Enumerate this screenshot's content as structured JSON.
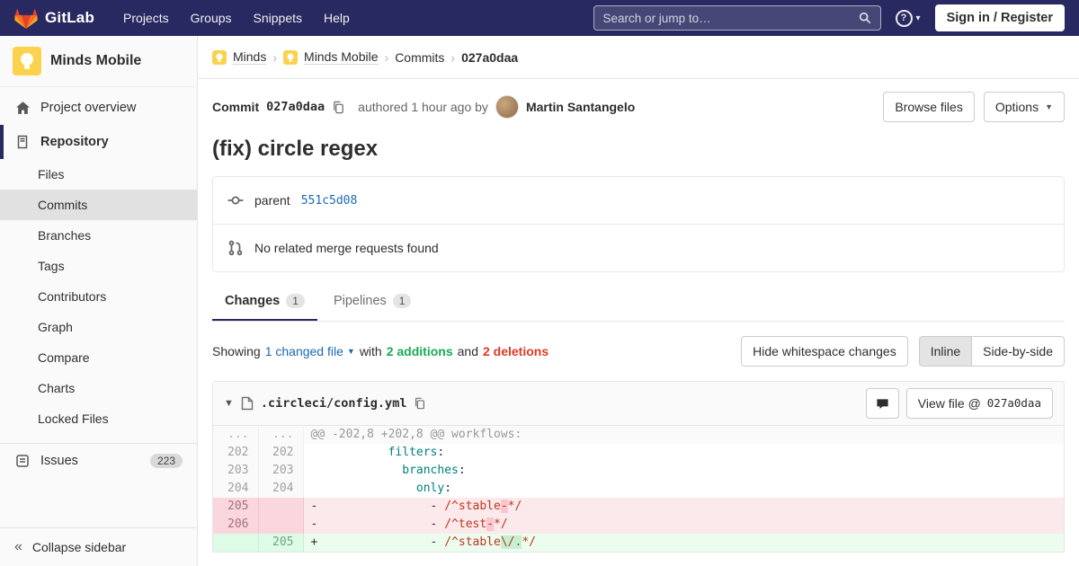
{
  "navbar": {
    "brand": "GitLab",
    "menu": [
      "Projects",
      "Groups",
      "Snippets",
      "Help"
    ],
    "search_placeholder": "Search or jump to…",
    "help_glyph": "?",
    "sign_in_label": "Sign in / Register"
  },
  "sidebar": {
    "project_name": "Minds Mobile",
    "overview_label": "Project overview",
    "repository_label": "Repository",
    "repo_items": [
      "Files",
      "Commits",
      "Branches",
      "Tags",
      "Contributors",
      "Graph",
      "Compare",
      "Charts",
      "Locked Files"
    ],
    "active_repo_item": "Commits",
    "issues_label": "Issues",
    "issues_count": "223",
    "collapse_label": "Collapse sidebar",
    "collapse_glyph": "«"
  },
  "breadcrumb": {
    "group": "Minds",
    "project": "Minds Mobile",
    "section": "Commits",
    "sha": "027a0daa"
  },
  "commit_bar": {
    "commit_label": "Commit",
    "sha": "027a0daa",
    "authored_text": "authored 1 hour ago by",
    "author": "Martin Santangelo",
    "browse_files_label": "Browse files",
    "options_label": "Options"
  },
  "commit": {
    "title": "(fix) circle regex",
    "parent_label": "parent",
    "parent_sha": "551c5d08",
    "related_mr_text": "No related merge requests found"
  },
  "tabs": {
    "changes_label": "Changes",
    "changes_count": "1",
    "pipelines_label": "Pipelines",
    "pipelines_count": "1"
  },
  "summary": {
    "showing_label": "Showing",
    "changed_file_label": "1 changed file",
    "with_label": "with",
    "additions_label": "2 additions",
    "and_label": "and",
    "deletions_label": "2 deletions",
    "hide_whitespace_label": "Hide whitespace changes",
    "inline_label": "Inline",
    "side_by_side_label": "Side-by-side"
  },
  "diff": {
    "file_name": ".circleci/config.yml",
    "view_file_label": "View file @",
    "view_file_sha": "027a0daa",
    "rows": [
      {
        "kind": "hunk",
        "old": "...",
        "new": "...",
        "segs": [
          [
            "@@ -202,8 +202,8 @@ workflows:",
            ""
          ]
        ]
      },
      {
        "kind": "ctx",
        "old": "202",
        "new": "202",
        "segs": [
          [
            "           ",
            ""
          ],
          [
            "filters",
            "key"
          ],
          [
            ":",
            ""
          ]
        ]
      },
      {
        "kind": "ctx",
        "old": "203",
        "new": "203",
        "segs": [
          [
            "             ",
            ""
          ],
          [
            "branches",
            "key"
          ],
          [
            ":",
            ""
          ]
        ]
      },
      {
        "kind": "ctx",
        "old": "204",
        "new": "204",
        "segs": [
          [
            "               ",
            ""
          ],
          [
            "only",
            "key"
          ],
          [
            ":",
            ""
          ]
        ]
      },
      {
        "kind": "del",
        "old": "205",
        "new": "",
        "segs": [
          [
            "-",
            ""
          ],
          [
            "                - ",
            ""
          ],
          [
            "/^stable",
            "str"
          ],
          [
            "-",
            "str hl-del"
          ],
          [
            "*/",
            "str"
          ]
        ]
      },
      {
        "kind": "del",
        "old": "206",
        "new": "",
        "segs": [
          [
            "-",
            ""
          ],
          [
            "                - ",
            ""
          ],
          [
            "/^test",
            "str"
          ],
          [
            "-",
            "str hl-del"
          ],
          [
            "*/",
            "str"
          ]
        ]
      },
      {
        "kind": "add",
        "old": "",
        "new": "205",
        "segs": [
          [
            "+",
            ""
          ],
          [
            "                - ",
            ""
          ],
          [
            "/^stable",
            "str"
          ],
          [
            "\\/.",
            "str hl-add"
          ],
          [
            "*/",
            "str"
          ]
        ]
      }
    ]
  },
  "colors": {
    "navbar_bg": "#292961",
    "link_blue": "#1b69b6",
    "addition_green": "#1aaa55",
    "deletion_red": "#db3b21",
    "del_line_bg": "#fbe9eb",
    "add_line_bg": "#ecfdf0",
    "brand_orange": "#fc6d26"
  }
}
